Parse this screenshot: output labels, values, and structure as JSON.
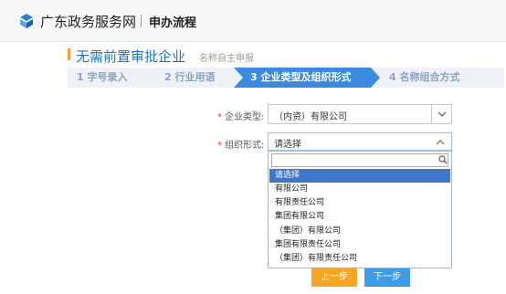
{
  "header": {
    "site_name": "广东政务服务网",
    "section_title": "申办流程"
  },
  "page": {
    "title": "无需前置审批企业",
    "subtitle": "名称自主申报"
  },
  "steps": [
    {
      "label": "1 字号录入",
      "active": false
    },
    {
      "label": "2 行业用语",
      "active": false
    },
    {
      "label": "3 企业类型及组织形式",
      "active": true
    },
    {
      "label": "4 名称组合方式",
      "active": false
    }
  ],
  "form": {
    "enterprise_type": {
      "label": "企业类型:",
      "value": "（内资）有限公司"
    },
    "org_form": {
      "label": "组织形式:",
      "value": "请选择",
      "search_value": "",
      "options": [
        "请选择",
        "有限公司",
        "有限责任公司",
        "集团有限公司",
        "（集团）有限公司",
        "集团有限责任公司",
        "（集团）有限责任公司"
      ],
      "selected_index": 0
    }
  },
  "buttons": {
    "prev": "上一步",
    "next": "下一步"
  },
  "colors": {
    "accent_blue": "#1e72c8",
    "step_active": "#3a8be0",
    "prev_button": "#f6a623",
    "next_button": "#3d9be8",
    "required_mark": "#ee3333"
  }
}
